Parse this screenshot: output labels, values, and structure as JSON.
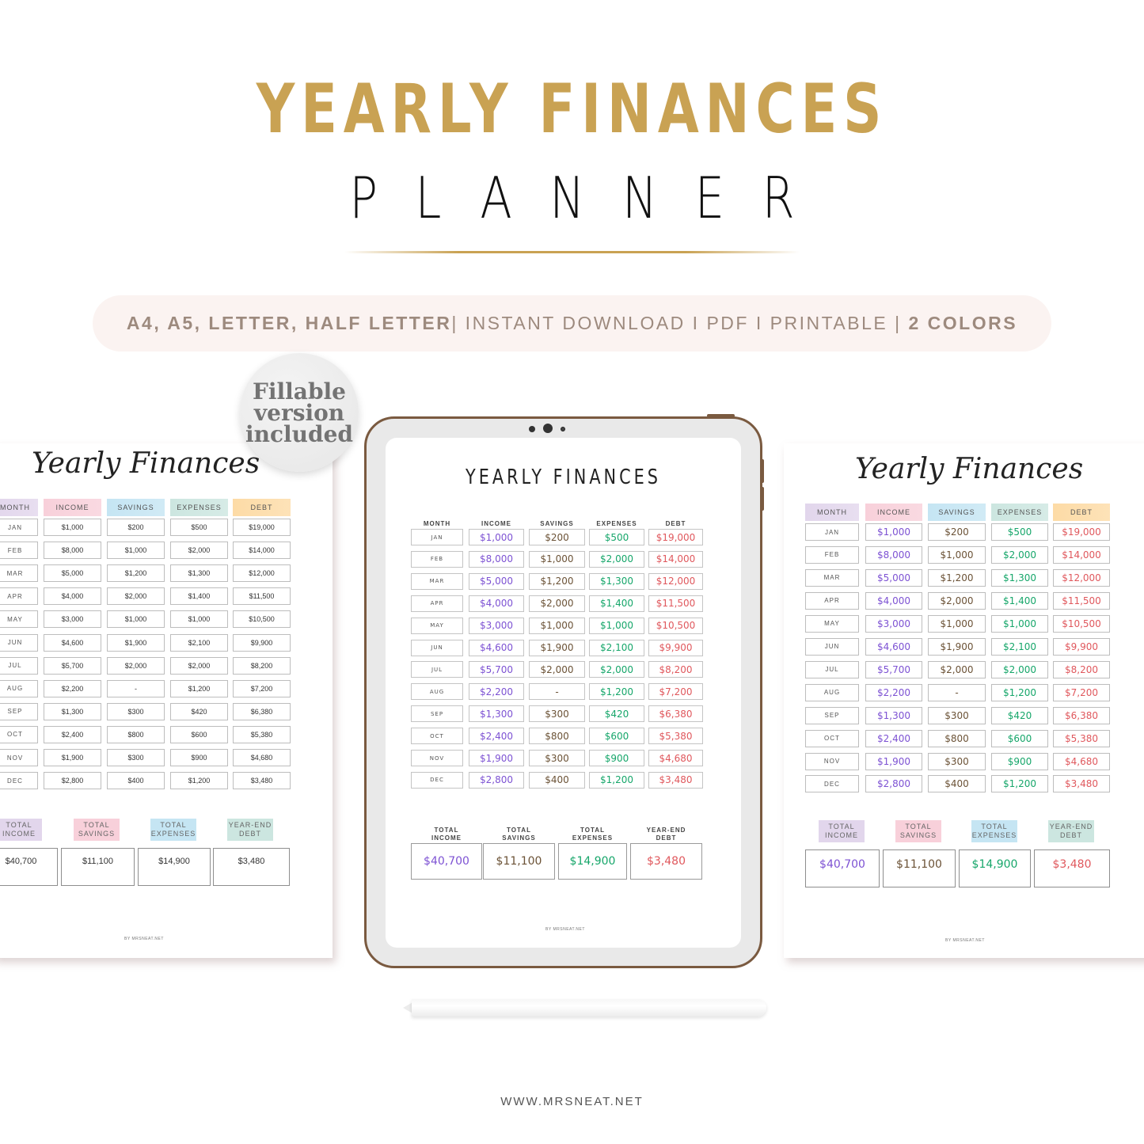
{
  "header": {
    "title": "YEARLY FINANCES",
    "subtitle": "PLANNER"
  },
  "banner": {
    "sizes": "A4, A5, LETTER, HALF LETTER",
    "middle": "| INSTANT DOWNLOAD I PDF I PRINTABLE | ",
    "colors": "2 COLORS"
  },
  "badge": {
    "line1": "Fillable",
    "line2": "version",
    "line3": "included"
  },
  "colors": {
    "gold": "#c9a253",
    "income": "#7d52d3",
    "savings": "#6b5236",
    "expenses": "#16a66a",
    "debt": "#e0585d",
    "tablet_frame": "#7a5a40",
    "hdr_month": "#e2d6ec",
    "hdr_income": "#f8d0da",
    "hdr_savings": "#c5e5f3",
    "hdr_expenses": "#cce6e0",
    "hdr_debt": "#fddba6"
  },
  "planner": {
    "script_title": "Yearly Finances",
    "tablet_title": "YEARLY FINANCES",
    "columns": [
      "MONTH",
      "INCOME",
      "SAVINGS",
      "EXPENSES",
      "DEBT"
    ],
    "rows": [
      {
        "month": "JAN",
        "income": "$1,000",
        "savings": "$200",
        "expenses": "$500",
        "debt": "$19,000"
      },
      {
        "month": "FEB",
        "income": "$8,000",
        "savings": "$1,000",
        "expenses": "$2,000",
        "debt": "$14,000"
      },
      {
        "month": "MAR",
        "income": "$5,000",
        "savings": "$1,200",
        "expenses": "$1,300",
        "debt": "$12,000"
      },
      {
        "month": "APR",
        "income": "$4,000",
        "savings": "$2,000",
        "expenses": "$1,400",
        "debt": "$11,500"
      },
      {
        "month": "MAY",
        "income": "$3,000",
        "savings": "$1,000",
        "expenses": "$1,000",
        "debt": "$10,500"
      },
      {
        "month": "JUN",
        "income": "$4,600",
        "savings": "$1,900",
        "expenses": "$2,100",
        "debt": "$9,900"
      },
      {
        "month": "JUL",
        "income": "$5,700",
        "savings": "$2,000",
        "expenses": "$2,000",
        "debt": "$8,200"
      },
      {
        "month": "AUG",
        "income": "$2,200",
        "savings": "-",
        "expenses": "$1,200",
        "debt": "$7,200"
      },
      {
        "month": "SEP",
        "income": "$1,300",
        "savings": "$300",
        "expenses": "$420",
        "debt": "$6,380"
      },
      {
        "month": "OCT",
        "income": "$2,400",
        "savings": "$800",
        "expenses": "$600",
        "debt": "$5,380"
      },
      {
        "month": "NOV",
        "income": "$1,900",
        "savings": "$300",
        "expenses": "$900",
        "debt": "$4,680"
      },
      {
        "month": "DEC",
        "income": "$2,800",
        "savings": "$400",
        "expenses": "$1,200",
        "debt": "$3,480"
      }
    ],
    "totals": [
      {
        "label1": "TOTAL",
        "label2": "INCOME",
        "value": "$40,700",
        "key": "income"
      },
      {
        "label1": "TOTAL",
        "label2": "SAVINGS",
        "value": "$11,100",
        "key": "savings"
      },
      {
        "label1": "TOTAL",
        "label2": "EXPENSES",
        "value": "$14,900",
        "key": "expenses"
      },
      {
        "label1": "YEAR-END",
        "label2": "DEBT",
        "value": "$3,480",
        "key": "debt"
      }
    ],
    "page_footer": "BY MRSNEAT.NET"
  },
  "footer": {
    "website": "WWW.MRSNEAT.NET"
  }
}
